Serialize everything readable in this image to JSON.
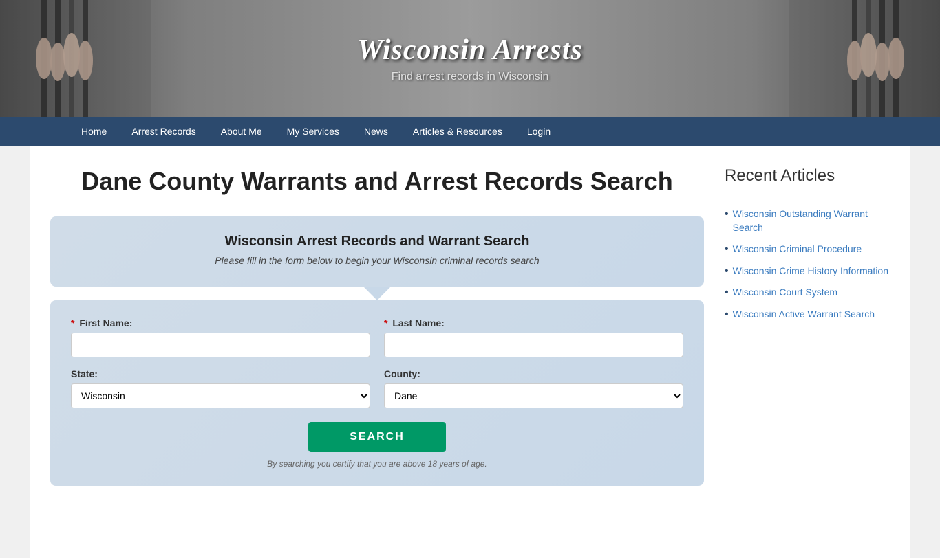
{
  "site": {
    "title": "Wisconsin Arrests",
    "subtitle": "Find arrest records in Wisconsin"
  },
  "nav": {
    "items": [
      {
        "label": "Home",
        "href": "#"
      },
      {
        "label": "Arrest Records",
        "href": "#"
      },
      {
        "label": "About Me",
        "href": "#"
      },
      {
        "label": "My Services",
        "href": "#"
      },
      {
        "label": "News",
        "href": "#"
      },
      {
        "label": "Articles & Resources",
        "href": "#"
      },
      {
        "label": "Login",
        "href": "#"
      }
    ]
  },
  "page": {
    "title": "Dane County Warrants and Arrest Records Search"
  },
  "search_form": {
    "heading": "Wisconsin Arrest Records and Warrant Search",
    "subheading": "Please fill in the form below to begin your Wisconsin criminal records search",
    "first_name_label": "First Name:",
    "last_name_label": "Last Name:",
    "state_label": "State:",
    "county_label": "County:",
    "state_default": "Wisconsin",
    "county_default": "Dane",
    "search_button": "SEARCH",
    "disclaimer": "By searching you certify that you are above 18 years of age.",
    "required_symbol": "*"
  },
  "sidebar": {
    "title": "Recent Articles",
    "articles": [
      {
        "label": "Wisconsin Outstanding Warrant Search",
        "href": "#"
      },
      {
        "label": "Wisconsin Criminal Procedure",
        "href": "#"
      },
      {
        "label": "Wisconsin Crime History Information",
        "href": "#"
      },
      {
        "label": "Wisconsin Court System",
        "href": "#"
      },
      {
        "label": "Wisconsin Active Warrant Search",
        "href": "#"
      }
    ]
  }
}
